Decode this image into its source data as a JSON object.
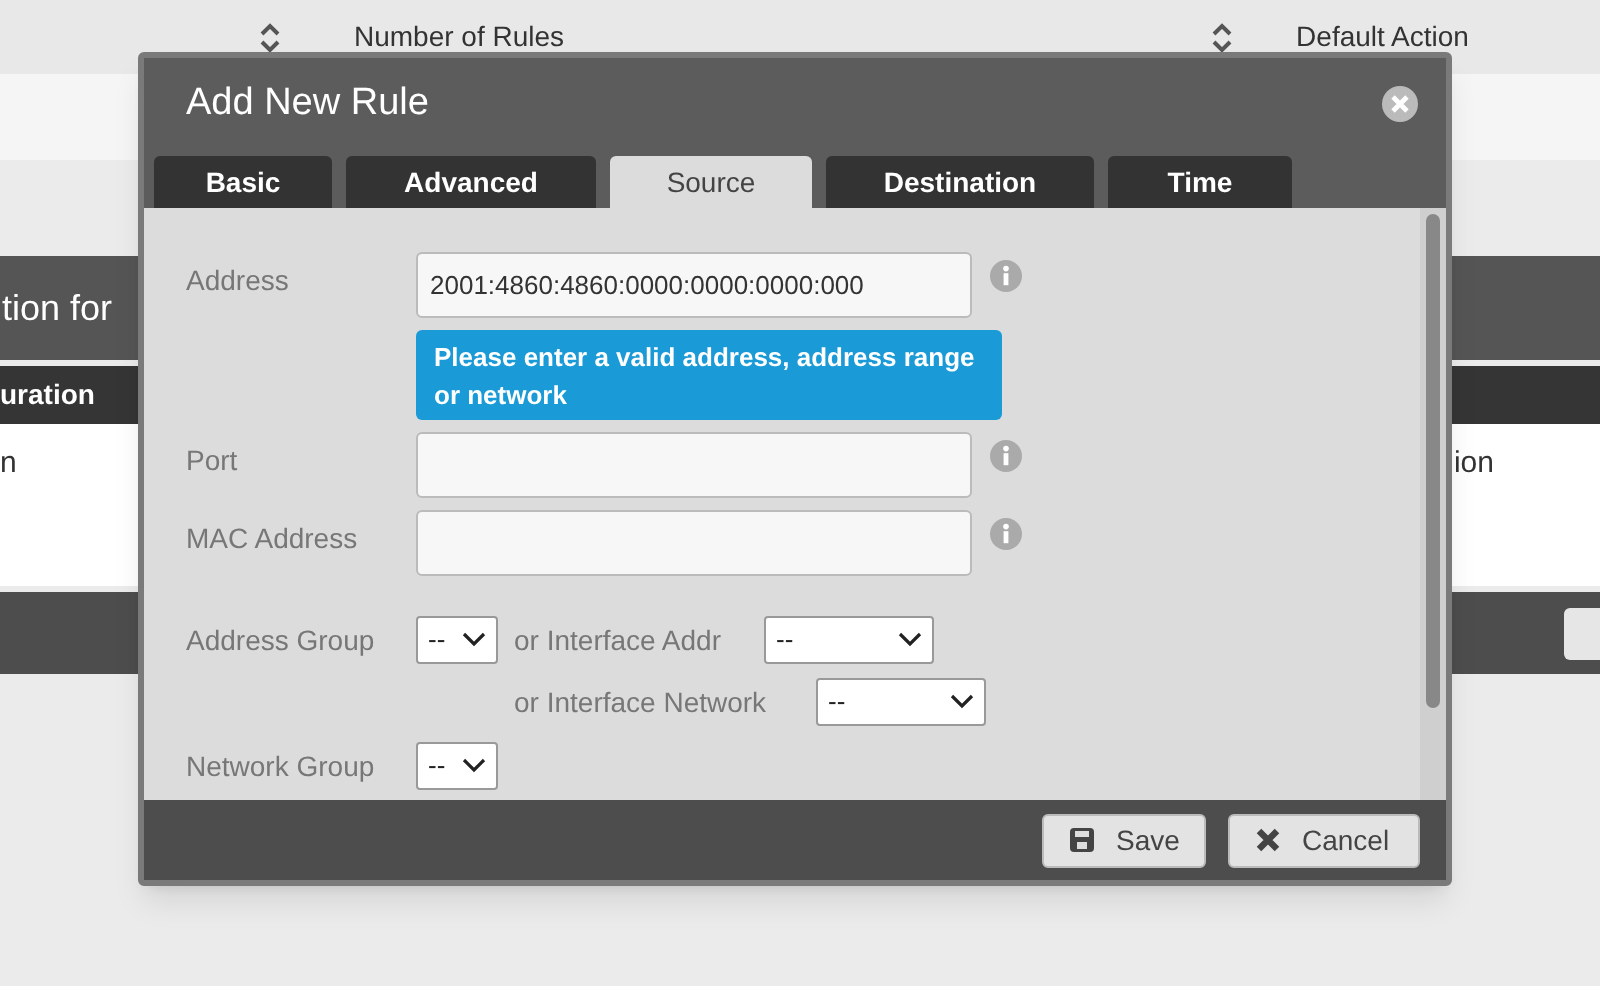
{
  "background": {
    "columns": [
      {
        "label": "Number of Rules"
      },
      {
        "label": "Default Action"
      }
    ],
    "panel_title": "tion for",
    "column_header": "uration",
    "row_cells": [
      "n",
      "ion"
    ]
  },
  "dialog": {
    "title": "Add New Rule",
    "tabs": [
      {
        "label": "Basic",
        "selected": false
      },
      {
        "label": "Advanced",
        "selected": false
      },
      {
        "label": "Source",
        "selected": true
      },
      {
        "label": "Destination",
        "selected": false
      },
      {
        "label": "Time",
        "selected": false
      }
    ],
    "address": {
      "label": "Address",
      "value": "2001:4860:4860:0000:0000:0000:000"
    },
    "tooltip": "Please enter a valid address, address range or network",
    "port": {
      "label": "Port"
    },
    "mac": {
      "label": "MAC Address"
    },
    "address_group": {
      "label": "Address Group",
      "value": "--"
    },
    "interface_addr": {
      "label": "or Interface Addr",
      "value": "--"
    },
    "interface_network": {
      "label": "or Interface Network",
      "value": "--"
    },
    "network_group": {
      "label": "Network Group",
      "value": "--"
    },
    "buttons": [
      {
        "kind": "save",
        "label": "Save"
      },
      {
        "kind": "cancel",
        "label": "Cancel"
      }
    ]
  }
}
